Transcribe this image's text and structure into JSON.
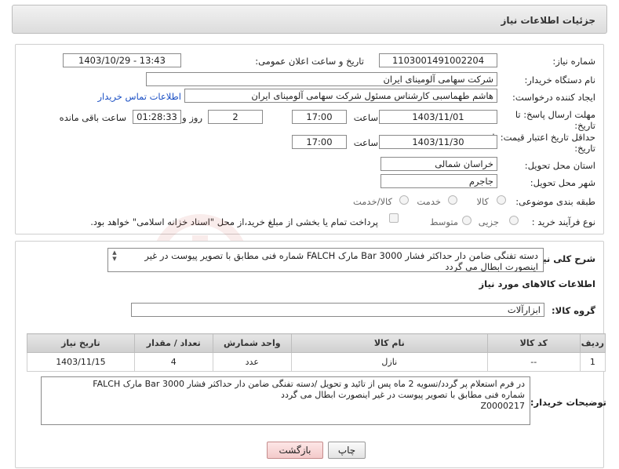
{
  "header": {
    "title": "جزئیات اطلاعات نیاز"
  },
  "form": {
    "need_number_label": "شماره نیاز:",
    "need_number": "1103001491002204",
    "announce_label": "تاریخ و ساعت اعلان عمومی:",
    "announce_value": "1403/10/29 - 13:43",
    "buyer_org_label": "نام دستگاه خریدار:",
    "buyer_org": "شرکت سهامی آلومینای ایران",
    "creator_label": "ایجاد کننده درخواست:",
    "creator": "هاشم طهماسبی کارشناس مسئول شرکت سهامی آلومینای ایران",
    "contact_link": "اطلاعات تماس خریدار",
    "deadline_label_1": "مهلت ارسال پاسخ: تا",
    "deadline_label_2": "تاریخ:",
    "deadline_date": "1403/11/01",
    "time_label": "ساعت",
    "deadline_time": "17:00",
    "days_value": "2",
    "days_label": "روز و",
    "remaining_time": "01:28:33",
    "remaining_label": "ساعت باقی مانده",
    "validity_label_1": "حداقل تاریخ اعتبار قیمت: تا",
    "validity_label_2": "تاریخ:",
    "validity_date": "1403/11/30",
    "validity_time": "17:00",
    "province_label": "استان محل تحویل:",
    "province": "خراسان شمالی",
    "city_label": "شهر محل تحویل:",
    "city": "جاجرم",
    "category_label": "طبقه بندی موضوعی:",
    "category_options": [
      "کالا",
      "خدمت",
      "کالا/خدمت"
    ],
    "process_label": "نوع فرآیند خرید :",
    "process_options": [
      "جزیی",
      "متوسط"
    ],
    "payment_note": "پرداخت تمام یا بخشی از مبلغ خرید،از محل \"اسناد خزانه اسلامی\" خواهد بود."
  },
  "details": {
    "summary_label": "شرح کلی نیاز:",
    "summary_text": "دسته تفنگی ضامن دار حداکثر فشار Bar 3000 مارک FALCH شماره فنی مطابق با تصویر پیوست در غیر اینصورت ابطال می گردد",
    "goods_info_title": "اطلاعات کالاهای مورد نیاز",
    "goods_group_label": "گروه کالا:",
    "goods_group": "ابزارآلات",
    "table": {
      "headers": [
        "ردیف",
        "کد کالا",
        "نام کالا",
        "واحد شمارش",
        "تعداد / مقدار",
        "تاریخ نیاز"
      ],
      "rows": [
        [
          "1",
          "--",
          "نازل",
          "عدد",
          "4",
          "1403/11/15"
        ]
      ]
    },
    "buyer_notes_label": "توضیحات خریدار:",
    "buyer_notes_lines": [
      "در فرم استعلام پر گردد/تسویه 2 ماه پس از تائید و تحویل /دسته تفنگی ضامن دار حداکثر فشار Bar 3000 مارک FALCH",
      "شماره فنی مطابق با تصویر پیوست در غیر اینصورت ابطال می گردد",
      "Z0000217"
    ]
  },
  "buttons": {
    "print": "چاپ",
    "back": "بازگشت"
  },
  "watermark": {
    "text": "AriaTender.neT"
  },
  "colors": {
    "link": "#1a4fc4",
    "back_button": "#f3caca",
    "watermark": "#c0392b"
  }
}
